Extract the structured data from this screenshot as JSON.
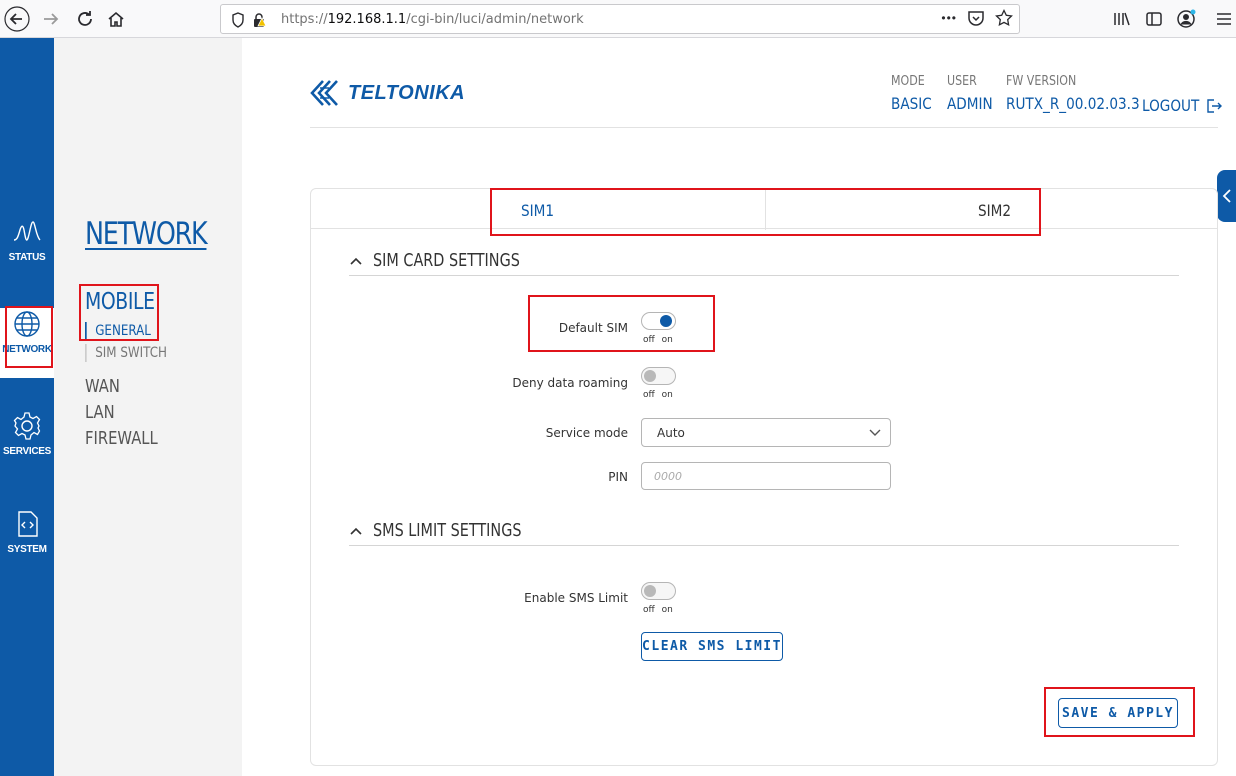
{
  "browser": {
    "url_prefix": "https://",
    "url_host": "192.168.1.1",
    "url_path": "/cgi-bin/luci/admin/network",
    "more_label": "•••"
  },
  "rail": {
    "items": [
      {
        "label": "STATUS",
        "icon": "pulse-icon"
      },
      {
        "label": "NETWORK",
        "icon": "globe-icon"
      },
      {
        "label": "SERVICES",
        "icon": "gear-icon"
      },
      {
        "label": "SYSTEM",
        "icon": "code-icon"
      }
    ]
  },
  "sidebar": {
    "title": "NETWORK",
    "mobile": "MOBILE",
    "sub_general": "GENERAL",
    "sub_simswitch": "SIM SWITCH",
    "links": [
      "WAN",
      "LAN",
      "FIREWALL"
    ]
  },
  "header": {
    "logo": "TELTONIKA",
    "mode_key": "MODE",
    "mode_val": "BASIC",
    "user_key": "USER",
    "user_val": "ADMIN",
    "fw_key": "FW VERSION",
    "fw_val": "RUTX_R_00.02.03.3",
    "logout": "LOGOUT"
  },
  "tabs": {
    "sim1": "SIM1",
    "sim2": "SIM2"
  },
  "sim_card": {
    "title": "SIM CARD SETTINGS",
    "default_sim_label": "Default SIM",
    "default_sim_on": true,
    "deny_roaming_label": "Deny data roaming",
    "deny_roaming_on": false,
    "toggle_caption": "off on",
    "service_mode_label": "Service mode",
    "service_mode_value": "Auto",
    "pin_label": "PIN",
    "pin_placeholder": "0000"
  },
  "sms_limit": {
    "title": "SMS LIMIT SETTINGS",
    "enable_label": "Enable SMS Limit",
    "enable_on": false,
    "clear_button": "CLEAR SMS LIMIT"
  },
  "save_button": "SAVE & APPLY",
  "colors": {
    "brand": "#0e5aa7",
    "highlight": "#e0141b"
  }
}
